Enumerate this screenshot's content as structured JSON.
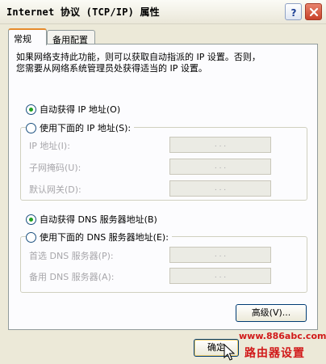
{
  "window": {
    "title": "Internet 协议 (TCP/IP) 属性",
    "help_label": "?",
    "close_label": "×"
  },
  "tabs": [
    {
      "label": "常规",
      "active": true
    },
    {
      "label": "备用配置",
      "active": false
    }
  ],
  "description": {
    "line1": "如果网络支持此功能，则可以获取自动指派的 IP 设置。否则，",
    "line2": "您需要从网络系统管理员处获得适当的 IP 设置。"
  },
  "ip_mode": {
    "auto_label": "自动获得 IP 地址(O)",
    "manual_label": "使用下面的 IP 地址(S):",
    "selected": "auto"
  },
  "ip_fields": [
    {
      "label": "IP 地址(I):",
      "value": ". . ."
    },
    {
      "label": "子网掩码(U):",
      "value": ". . ."
    },
    {
      "label": "默认网关(D):",
      "value": ". . ."
    }
  ],
  "dns_mode": {
    "auto_label": "自动获得 DNS 服务器地址(B)",
    "manual_label": "使用下面的 DNS 服务器地址(E):",
    "selected": "auto"
  },
  "dns_fields": [
    {
      "label": "首选 DNS 服务器(P):",
      "value": ". . ."
    },
    {
      "label": "备用 DNS 服务器(A):",
      "value": ". . ."
    }
  ],
  "buttons": {
    "advanced_label": "高级(V)...",
    "ok_label": "确定"
  },
  "watermark": {
    "url": "www.886abc.com",
    "text": "路由器设置"
  },
  "colors": {
    "accent_tab": "#e68b2c",
    "radio_dot": "#21a121",
    "close_button": "#c8412a",
    "watermark": "#d11a1a"
  }
}
